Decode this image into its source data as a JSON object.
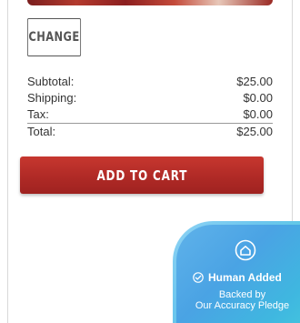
{
  "actions": {
    "change_label": "CHANGE",
    "add_to_cart_label": "ADD TO CART"
  },
  "summary": {
    "rows": [
      {
        "label": "Subtotal:",
        "value": "$25.00"
      },
      {
        "label": "Shipping:",
        "value": "$0.00"
      },
      {
        "label": "Tax:",
        "value": "$0.00"
      },
      {
        "label": "Total:",
        "value": "$25.00"
      }
    ]
  },
  "badge": {
    "title": "Human Added",
    "line1": "Backed by",
    "line2": "Our Accuracy Pledge"
  },
  "colors": {
    "button_red": "#b02a26",
    "badge_blue": "#4aa3e4",
    "badge_teal": "#4fd6d6"
  },
  "icons": {
    "badge_top": "home-icon",
    "badge_check": "check-circle-icon"
  }
}
